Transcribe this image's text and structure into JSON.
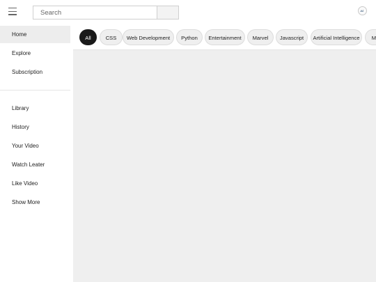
{
  "header": {
    "search": {
      "placeholder": "Search",
      "value": ""
    }
  },
  "sidebar": {
    "items": [
      {
        "label": "Home",
        "active": true
      },
      {
        "label": "Explore",
        "active": false
      },
      {
        "label": "Subscription",
        "active": false
      },
      {
        "label": "Library",
        "active": false
      },
      {
        "label": "History",
        "active": false
      },
      {
        "label": "Your Video",
        "active": false
      },
      {
        "label": "Watch Leater",
        "active": false
      },
      {
        "label": "Like Video",
        "active": false
      },
      {
        "label": "Show More",
        "active": false
      }
    ]
  },
  "chips": [
    {
      "label": "All",
      "active": true
    },
    {
      "label": "CSS",
      "active": false
    },
    {
      "label": "Web Development",
      "active": false
    },
    {
      "label": "Python",
      "active": false
    },
    {
      "label": "Entertainment",
      "active": false
    },
    {
      "label": "Marvel",
      "active": false
    },
    {
      "label": "Javascript",
      "active": false
    },
    {
      "label": "Artificial Intelligence",
      "active": false
    },
    {
      "label": "Ma",
      "active": false
    }
  ],
  "colors": {
    "active_chip": "#1a1a1a",
    "chip_bg": "#efefef",
    "content_bg": "#efefef",
    "sidebar_active": "#ededed"
  }
}
